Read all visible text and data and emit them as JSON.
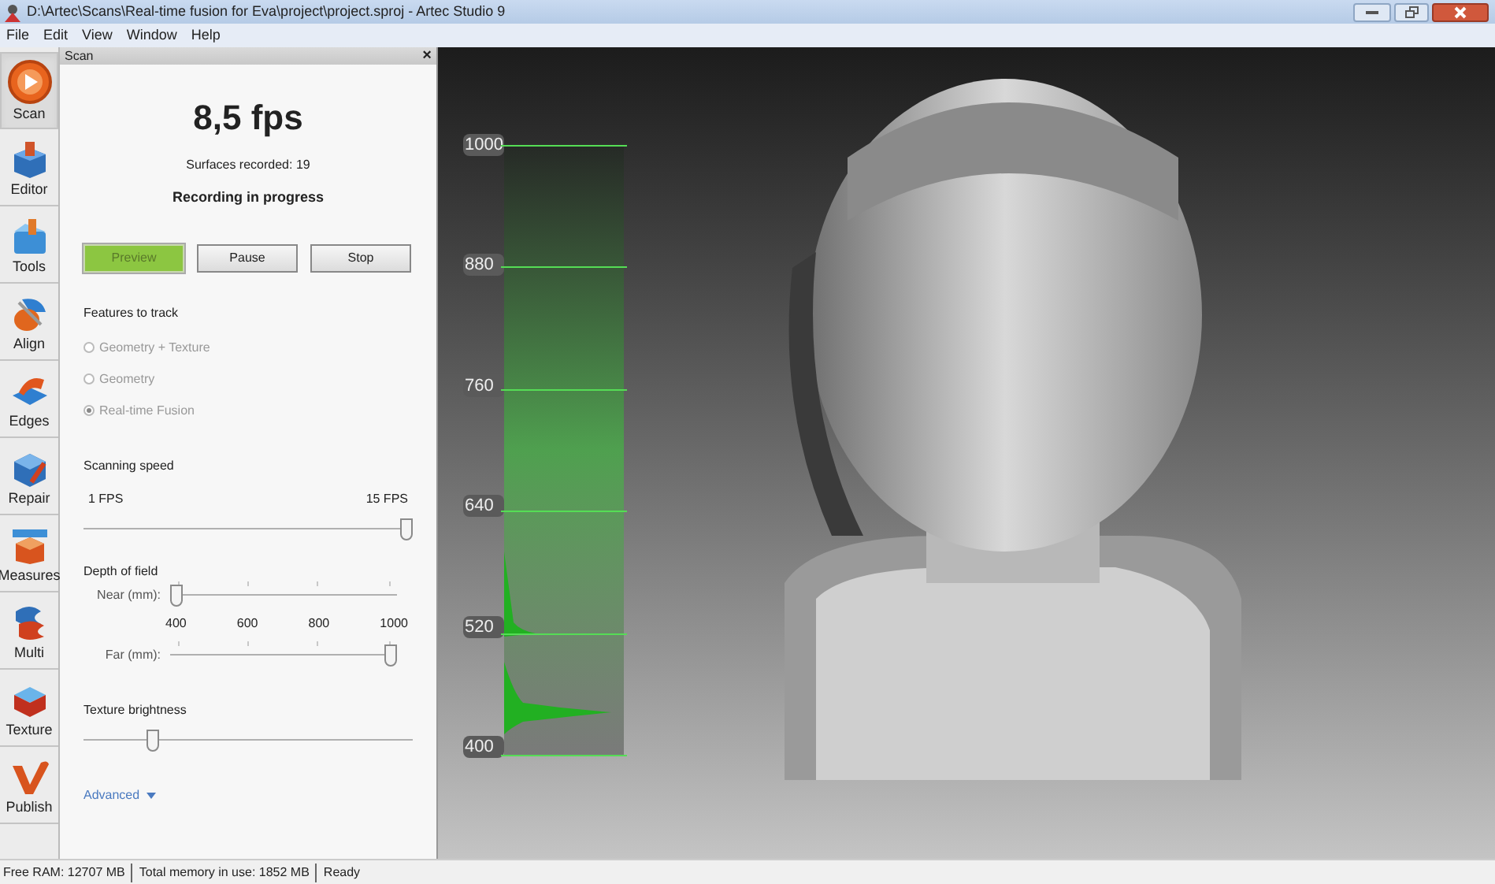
{
  "window": {
    "title": "D:\\Artec\\Scans\\Real-time fusion for Eva\\project\\project.sproj - Artec Studio 9"
  },
  "menu": [
    "File",
    "Edit",
    "View",
    "Window",
    "Help"
  ],
  "toolbar": [
    {
      "label": "Scan",
      "selected": true
    },
    {
      "label": "Editor",
      "selected": false
    },
    {
      "label": "Tools",
      "selected": false
    },
    {
      "label": "Align",
      "selected": false
    },
    {
      "label": "Edges",
      "selected": false
    },
    {
      "label": "Repair",
      "selected": false
    },
    {
      "label": "Measures",
      "selected": false
    },
    {
      "label": "Multi",
      "selected": false
    },
    {
      "label": "Texture",
      "selected": false
    },
    {
      "label": "Publish",
      "selected": false
    }
  ],
  "panel": {
    "title": "Scan",
    "close": "×",
    "fps": "8,5 fps",
    "surfaces": "Surfaces recorded: 19",
    "status": "Recording in progress",
    "buttons": [
      {
        "label": "Preview",
        "selected": true
      },
      {
        "label": "Pause",
        "selected": false
      },
      {
        "label": "Stop",
        "selected": false
      }
    ],
    "features_label": "Features to track",
    "features": [
      {
        "label": "Geometry + Texture",
        "selected": false,
        "disabled": true
      },
      {
        "label": "Geometry",
        "selected": false,
        "disabled": true
      },
      {
        "label": "Real-time Fusion",
        "selected": true,
        "disabled": true
      }
    ],
    "speed": {
      "label": "Scanning speed",
      "min": "1 FPS",
      "max": "15 FPS",
      "level": 1.0
    },
    "depth": {
      "label": "Depth of field",
      "near": {
        "label": "Near (mm):",
        "level": 0.0
      },
      "ticks": [
        "400",
        "600",
        "800",
        "1000"
      ],
      "far": {
        "label": "Far (mm):",
        "level": 1.0
      }
    },
    "brightness": {
      "label": "Texture brightness",
      "level": 0.2
    },
    "advanced": "Advanced"
  },
  "viewport": {
    "depth_scale": [
      "1000",
      "880",
      "760",
      "640",
      "520",
      "400"
    ]
  },
  "status_bar": [
    "Free RAM: 12707 MB",
    "Total memory in use: 1852 MB",
    "Ready"
  ]
}
